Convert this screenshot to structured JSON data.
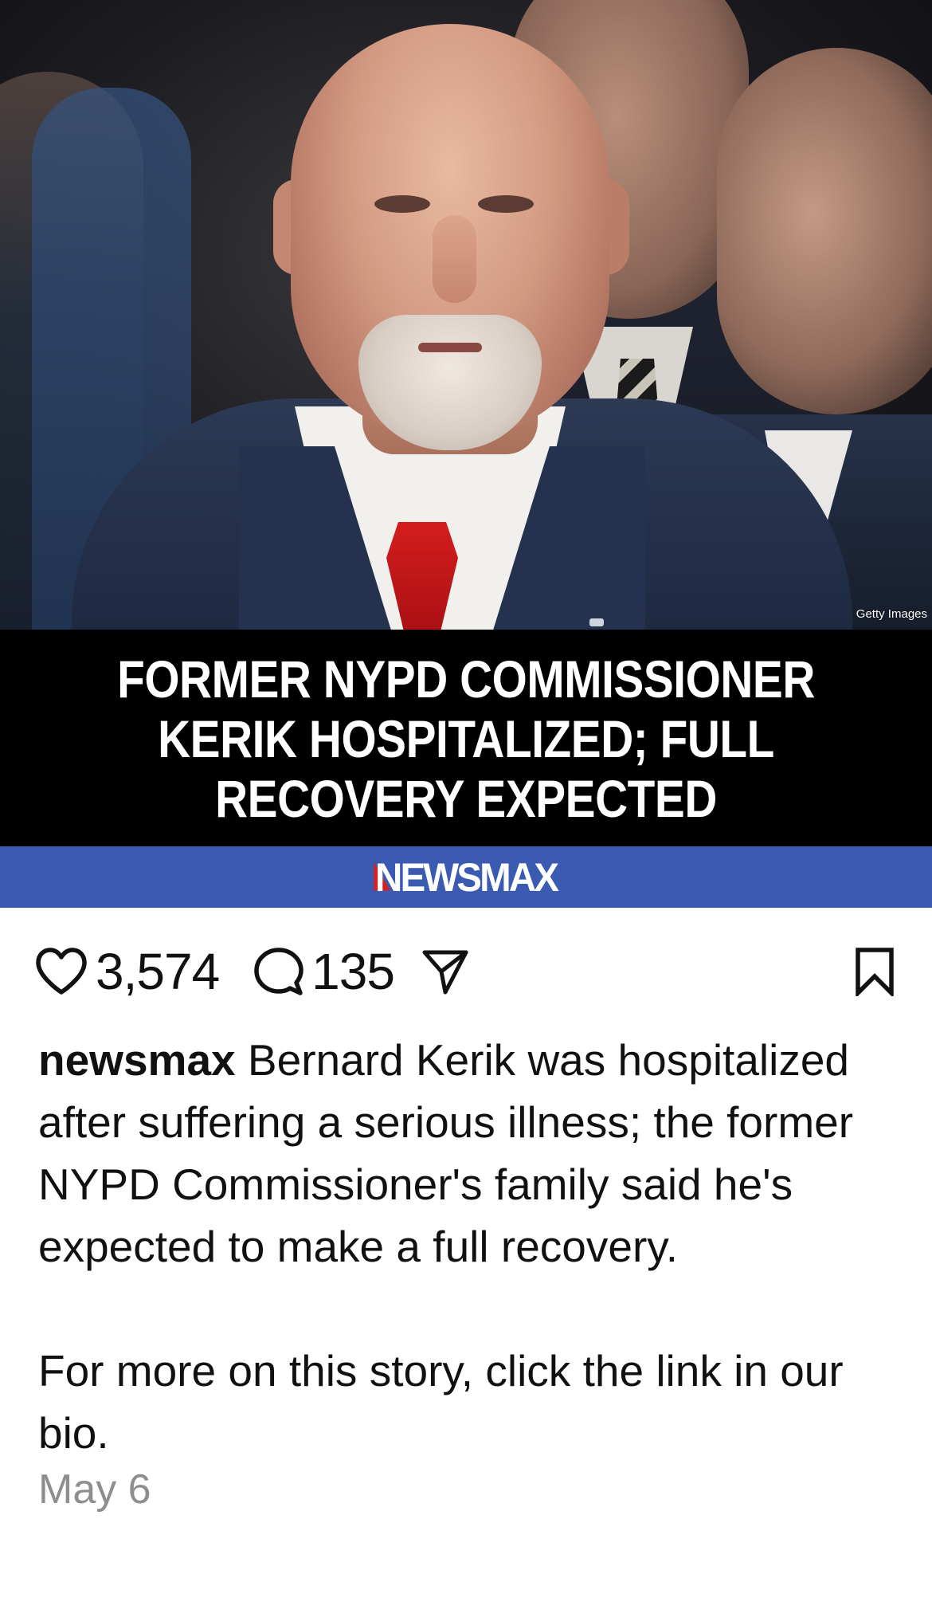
{
  "post": {
    "image": {
      "credit": "Getty Images",
      "headline_lines": [
        "FORMER NYPD COMMISSIONER",
        "KERIK HOSPITALIZED; FULL",
        "RECOVERY EXPECTED"
      ],
      "brand": "NEWSMAX",
      "brand_color": "#3b5bb3",
      "brand_accent_color": "#d42222"
    },
    "actions": {
      "like_icon": "heart-outline-icon",
      "likes": "3,574",
      "comment_icon": "comment-bubble-icon",
      "comments": "135",
      "share_icon": "paper-plane-icon",
      "save_icon": "bookmark-outline-icon"
    },
    "caption": {
      "username": "newsmax",
      "text": "Bernard Kerik was hospitalized after suffering a serious illness; the former NYPD Commissioner's family said he's expected to make a full recovery.",
      "text_2": "For more on this story, click the link in our bio."
    },
    "date": "May 6"
  }
}
